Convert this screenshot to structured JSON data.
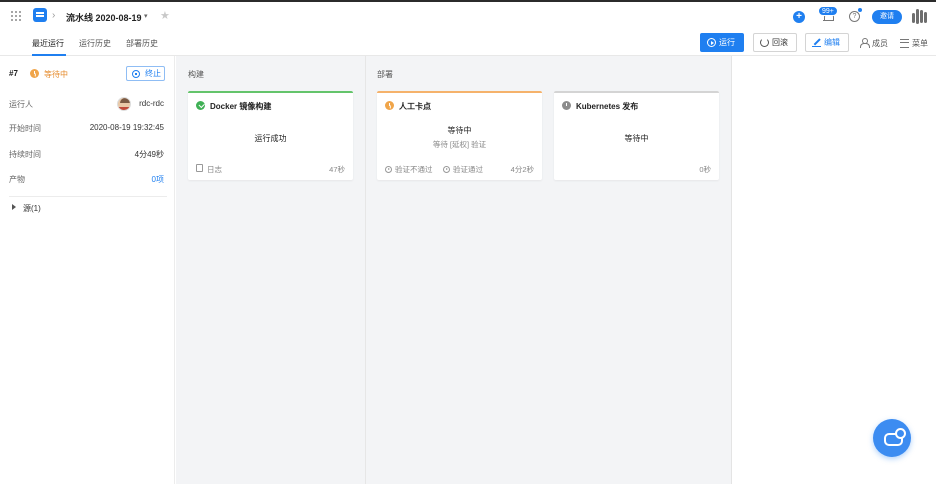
{
  "header": {
    "pipeline_name": "流水线 2020-08-19",
    "notification_badge": "99+",
    "help_label": "?",
    "invite_label": "邀请",
    "plus_label": "+"
  },
  "tabs": [
    {
      "label": "最近运行",
      "active": true
    },
    {
      "label": "运行历史",
      "active": false
    },
    {
      "label": "部署历史",
      "active": false
    }
  ],
  "toolbar": {
    "run_label": "运行",
    "rollback_label": "回滚",
    "edit_label": "编辑",
    "members_label": "成员",
    "menu_label": "菜单"
  },
  "run": {
    "number": "#7",
    "status": "等待中",
    "stop_label": "终止",
    "details": [
      {
        "label": "运行人",
        "value": "rdc-rdc"
      },
      {
        "label": "开始时间",
        "value": "2020-08-19 19:32:45"
      },
      {
        "label": "持续时间",
        "value": "4分49秒"
      },
      {
        "label": "产物",
        "value": "0项"
      }
    ],
    "source_label": "源(1)"
  },
  "stages": [
    {
      "title": "构建",
      "jobs": [
        {
          "name": "Docker 镜像构建",
          "status": "运行成功",
          "footer": "日志",
          "duration": "47秒"
        }
      ]
    },
    {
      "title": "部署",
      "jobs": [
        {
          "name": "人工卡点",
          "status": "等待中",
          "sub": "等待 [延权] 验证",
          "action_reject": "验证不通过",
          "action_approve": "验证通过",
          "duration": "4分2秒"
        },
        {
          "name": "Kubernetes 发布",
          "status": "等待中",
          "duration": "0秒"
        }
      ]
    }
  ],
  "colors": {
    "accent": "#1f7ff0",
    "success": "#3fb055",
    "waiting": "#f0a54a",
    "pending": "#d0d0d0"
  }
}
